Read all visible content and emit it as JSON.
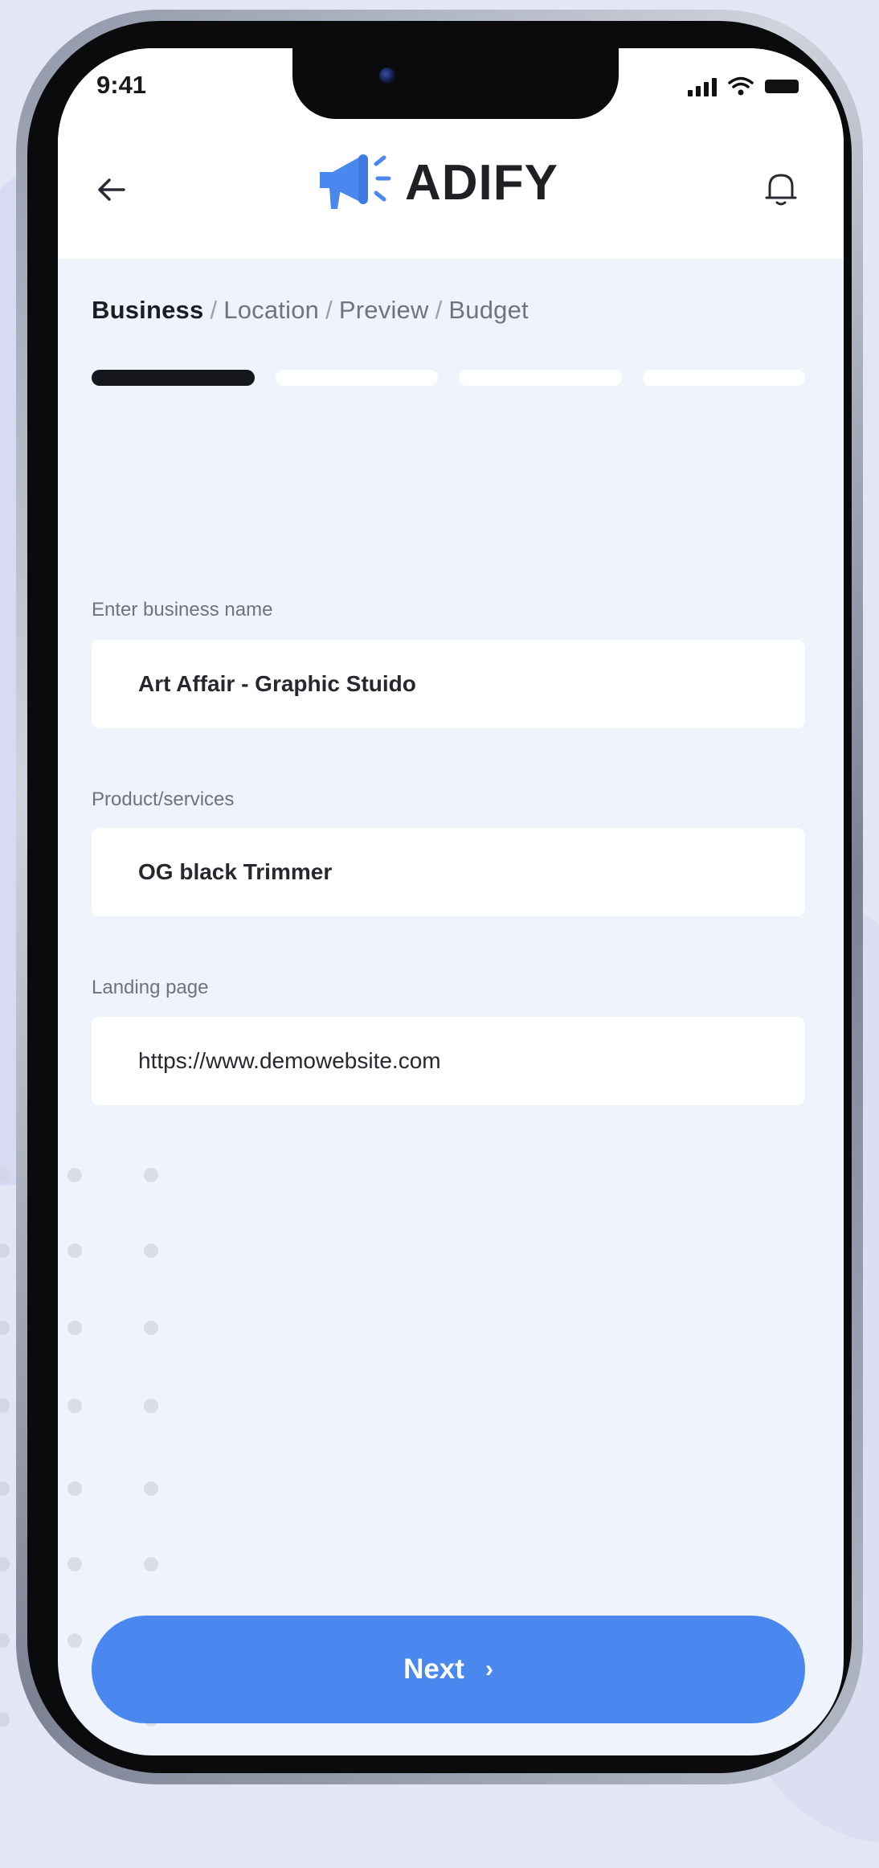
{
  "status_bar": {
    "time": "9:41"
  },
  "header": {
    "brand": "ADIFY",
    "logo_icon": "megaphone-icon",
    "back_icon": "arrow-left-icon",
    "notification_icon": "bell-icon"
  },
  "steps": [
    {
      "label": "Business",
      "active": true
    },
    {
      "label": "Location",
      "active": false
    },
    {
      "label": "Preview",
      "active": false
    },
    {
      "label": "Budget",
      "active": false
    }
  ],
  "step_separator": "/",
  "progress": {
    "current_step": 1,
    "total_steps": 4
  },
  "form": {
    "business_name": {
      "label": "Enter business name",
      "value": "Art Affair - Graphic Stuido"
    },
    "product": {
      "label": "Product/services",
      "value": "OG black Trimmer"
    },
    "landing_page": {
      "label": "Landing page",
      "value": "https://www.demowebsite.com"
    }
  },
  "next_button": {
    "label": "Next",
    "chevron": "›"
  },
  "colors": {
    "accent": "#4a88f0",
    "progress_active": "#16171c",
    "progress_inactive": "#ffffff",
    "screen_bg": "#eef3fc"
  }
}
